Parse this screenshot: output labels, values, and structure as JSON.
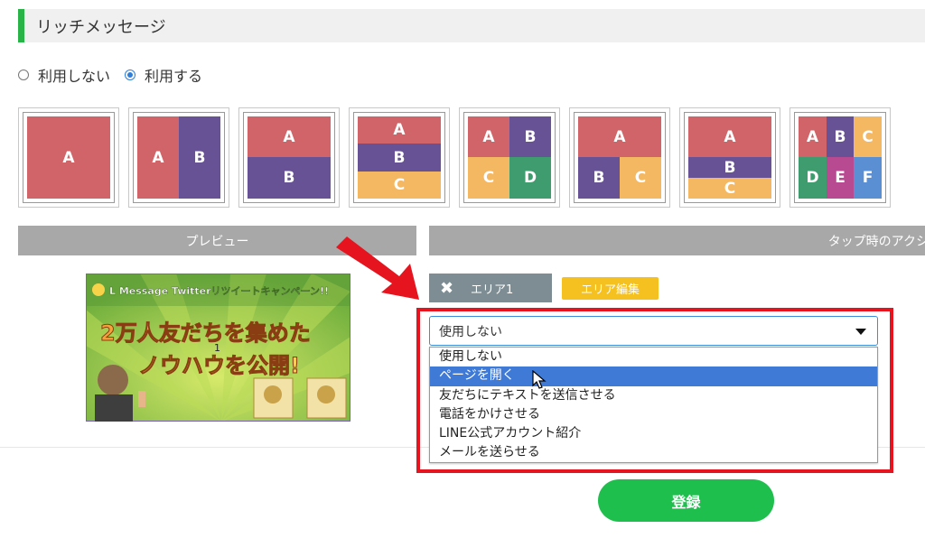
{
  "section": {
    "title": "リッチメッセージ"
  },
  "radios": [
    {
      "label": "利用しない",
      "checked": false
    },
    {
      "label": "利用する",
      "checked": true
    }
  ],
  "layouts": [
    {
      "name": "layout-1",
      "cells": [
        "A"
      ]
    },
    {
      "name": "layout-2",
      "cells": [
        "A",
        "B"
      ]
    },
    {
      "name": "layout-3",
      "cells": [
        "A",
        "B"
      ]
    },
    {
      "name": "layout-4",
      "cells": [
        "A",
        "B",
        "C"
      ]
    },
    {
      "name": "layout-5",
      "cells": [
        "A",
        "B",
        "C",
        "D"
      ]
    },
    {
      "name": "layout-6",
      "cells": [
        "A",
        "B",
        "C"
      ]
    },
    {
      "name": "layout-7",
      "cells": [
        "A",
        "B",
        "C"
      ]
    },
    {
      "name": "layout-8",
      "cells": [
        "A",
        "B",
        "C",
        "D",
        "E",
        "F"
      ]
    }
  ],
  "preview_bar": {
    "label": "プレビュー"
  },
  "action_bar": {
    "label": "タップ時のアクシ"
  },
  "preview_image": {
    "top_line": "L Message Twitterリツイートキャンペーン!!",
    "headline1": "2万人友だちを集めた",
    "headline2": "ノウハウを公開!",
    "marker": "1"
  },
  "area": {
    "tab_label": "エリア1",
    "edit_label": "エリア編集"
  },
  "action_select": {
    "value": "使用しない",
    "options": [
      "使用しない",
      "ページを開く",
      "友だちにテキストを送信させる",
      "電話をかけさせる",
      "LINE公式アカウント紹介",
      "メールを送らせる"
    ],
    "highlighted_index": 1
  },
  "submit": {
    "label": "登録"
  },
  "colors": {
    "accent": "#28b446",
    "red": "#d06468",
    "purple": "#675295",
    "orange": "#f4b762",
    "green": "#3f9c6e",
    "magenta": "#b74a91",
    "blue": "#5a8fd4",
    "highlight": "#e5141e"
  }
}
